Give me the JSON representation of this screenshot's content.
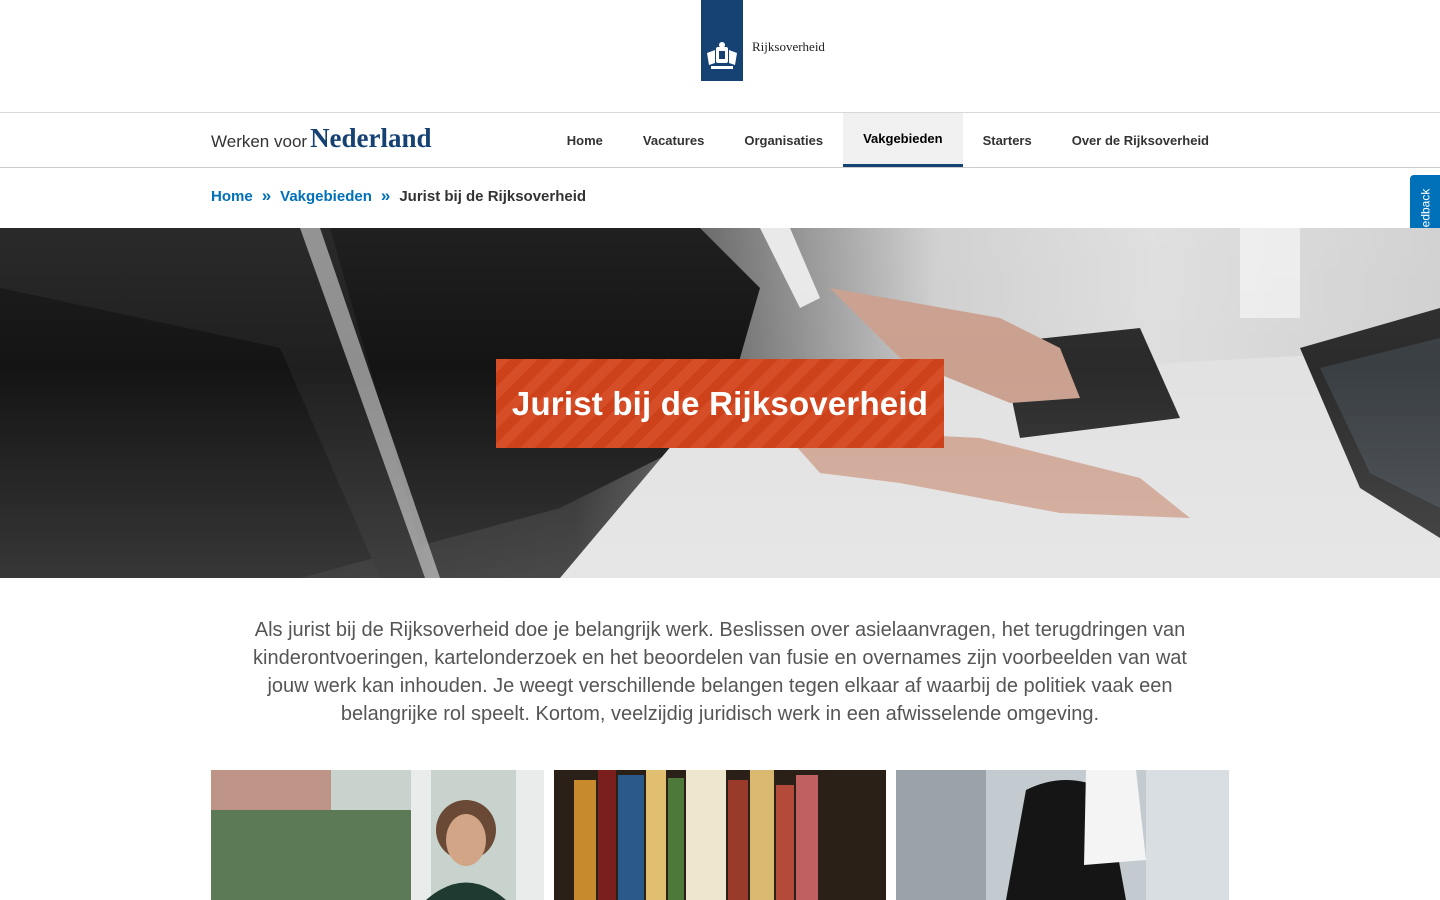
{
  "header": {
    "logo_text": "Rijksoverheid",
    "site_brand_small": "Werken voor",
    "site_brand_big": "Nederland"
  },
  "nav": {
    "items": [
      {
        "label": "Home"
      },
      {
        "label": "Vacatures"
      },
      {
        "label": "Organisaties"
      },
      {
        "label": "Vakgebieden",
        "active": true
      },
      {
        "label": "Starters"
      },
      {
        "label": "Over de Rijksoverheid"
      }
    ]
  },
  "breadcrumb": {
    "items": [
      "Home",
      "Vakgebieden"
    ],
    "separator": "»",
    "current": "Jurist bij de Rijksoverheid"
  },
  "feedback": {
    "label": "Feedback"
  },
  "hero": {
    "title": "Jurist bij de Rijksoverheid"
  },
  "intro": {
    "text": "Als jurist bij de Rijksoverheid doe je belangrijk werk. Beslissen over asielaanvragen, het terugdringen van kinderontvoeringen, kartelonderzoek en het beoordelen van fusie en overnames zijn voorbeelden van wat jouw werk kan inhouden. Je weegt verschillende belangen tegen elkaar af waarbij de politiek vaak een belangrijke rol speelt. Kortom, veelzijdig juridisch werk in een afwisselende omgeving."
  },
  "colors": {
    "brand_blue": "#154273",
    "link_blue": "#0070b8",
    "hero_orange": "#d4441c"
  },
  "icons": {
    "logo": "rijksoverheid-crest-icon"
  }
}
